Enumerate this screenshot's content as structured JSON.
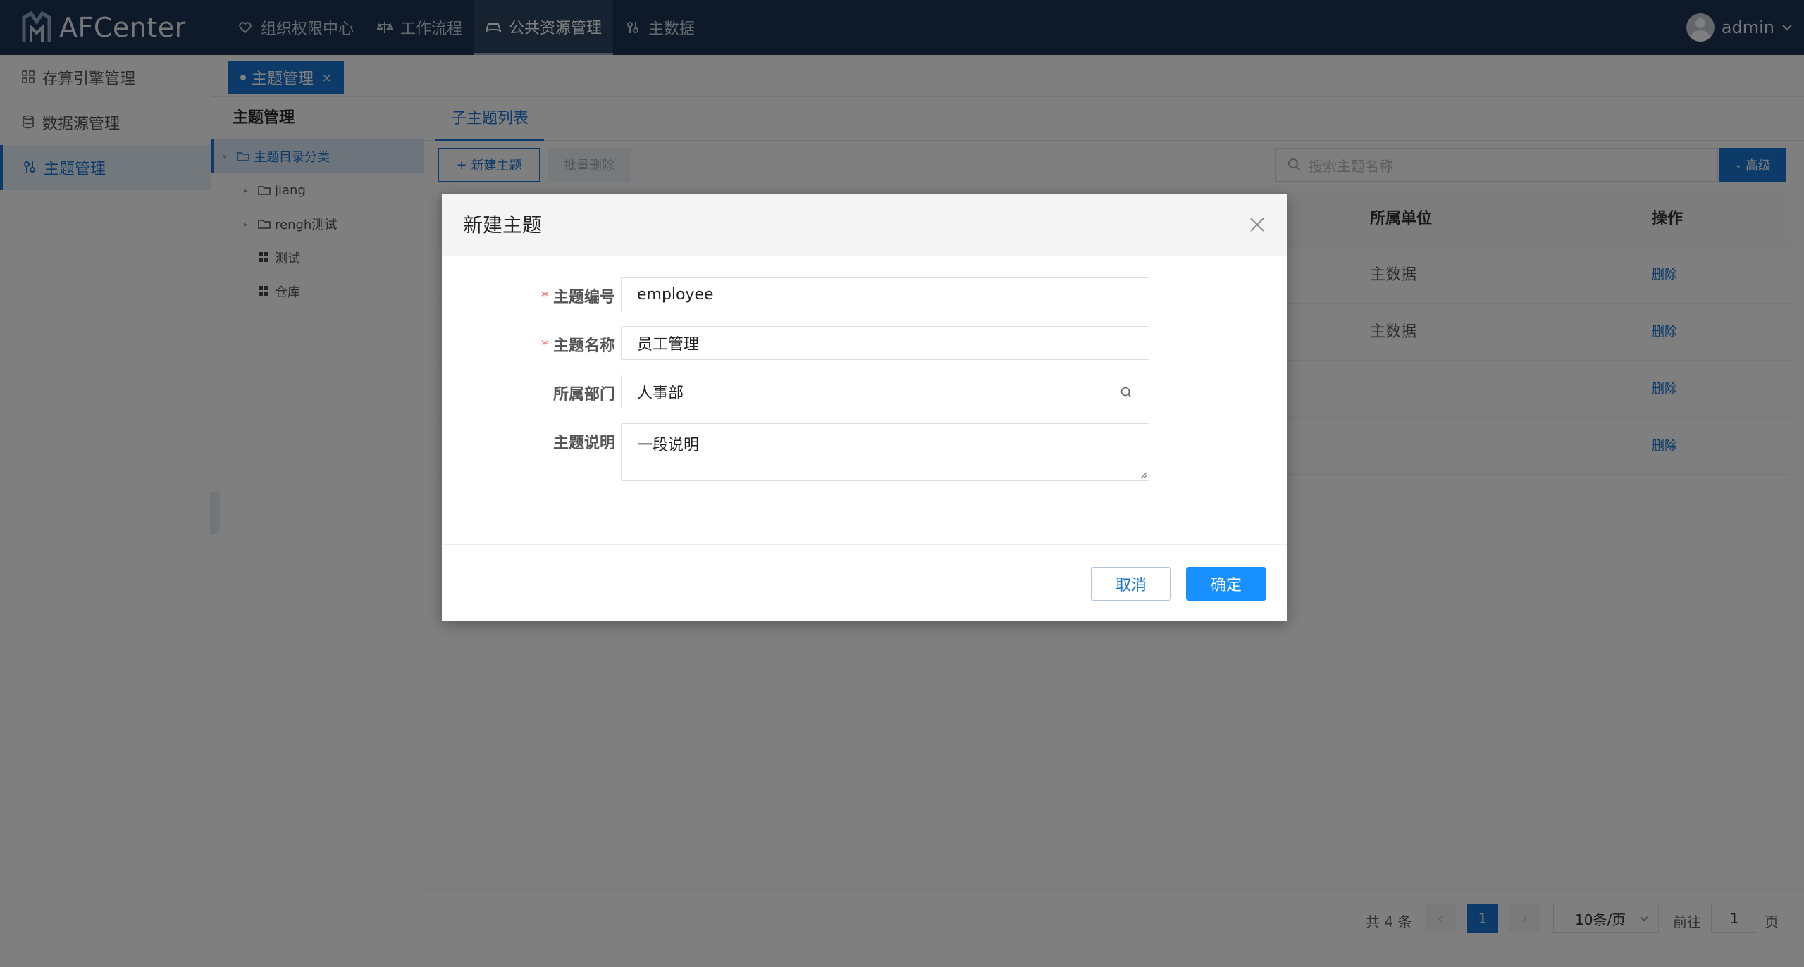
{
  "app": {
    "logo_text": "AFCenter",
    "user_name": "admin"
  },
  "topnav": {
    "items": [
      {
        "label": "组织权限中心",
        "icon": "heart-shield-icon"
      },
      {
        "label": "工作流程",
        "icon": "scale-icon"
      },
      {
        "label": "公共资源管理",
        "icon": "gamepad-icon",
        "active": true
      },
      {
        "label": "主数据",
        "icon": "key-icon"
      }
    ]
  },
  "sidebar": {
    "items": [
      {
        "label": "存算引擎管理",
        "icon": "grid-icon"
      },
      {
        "label": "数据源管理",
        "icon": "database-icon"
      },
      {
        "label": "主题管理",
        "icon": "key-icon",
        "active": true
      }
    ]
  },
  "page_tabs": [
    {
      "label": "主题管理",
      "close": "×"
    }
  ],
  "tree": {
    "title": "主题管理",
    "root": {
      "label": "主题目录分类"
    },
    "children": [
      {
        "label": "jiang",
        "type": "folder"
      },
      {
        "label": "rengh测试",
        "type": "folder"
      },
      {
        "label": "测试",
        "type": "grid"
      },
      {
        "label": "仓库",
        "type": "grid"
      }
    ]
  },
  "main": {
    "subtab": "子主题列表",
    "new_button": "新建主题",
    "batch_delete_button": "批量删除",
    "search_placeholder": "搜索主题名称",
    "advanced_button": "高级",
    "table": {
      "headers": {
        "unit": "所属单位",
        "actions": "操作"
      },
      "rows": [
        {
          "unit": "主数据",
          "action": "删除"
        },
        {
          "unit": "主数据",
          "action": "删除"
        },
        {
          "unit": "",
          "action": "删除"
        },
        {
          "unit": "",
          "action": "删除"
        }
      ]
    },
    "pagination": {
      "total": "共 4 条",
      "prev": "‹",
      "current": "1",
      "next": "›",
      "page_size": "10条/页",
      "goto_label": "前往",
      "goto_value": "1",
      "page_suffix": "页"
    }
  },
  "dialog": {
    "title": "新建主题",
    "fields": [
      {
        "label": "主题编号",
        "required": true,
        "value": "employee"
      },
      {
        "label": "主题名称",
        "required": true,
        "value": "员工管理"
      },
      {
        "label": "所属部门",
        "required": false,
        "value": "人事部"
      },
      {
        "label": "主题说明",
        "required": false,
        "value": "一段说明"
      }
    ],
    "cancel_button": "取消",
    "ok_button": "确定"
  },
  "colors": {
    "topbar": "#1c3352",
    "primary": "#1976d2",
    "ok_button": "#1890ff",
    "required": "#f56c6c"
  }
}
